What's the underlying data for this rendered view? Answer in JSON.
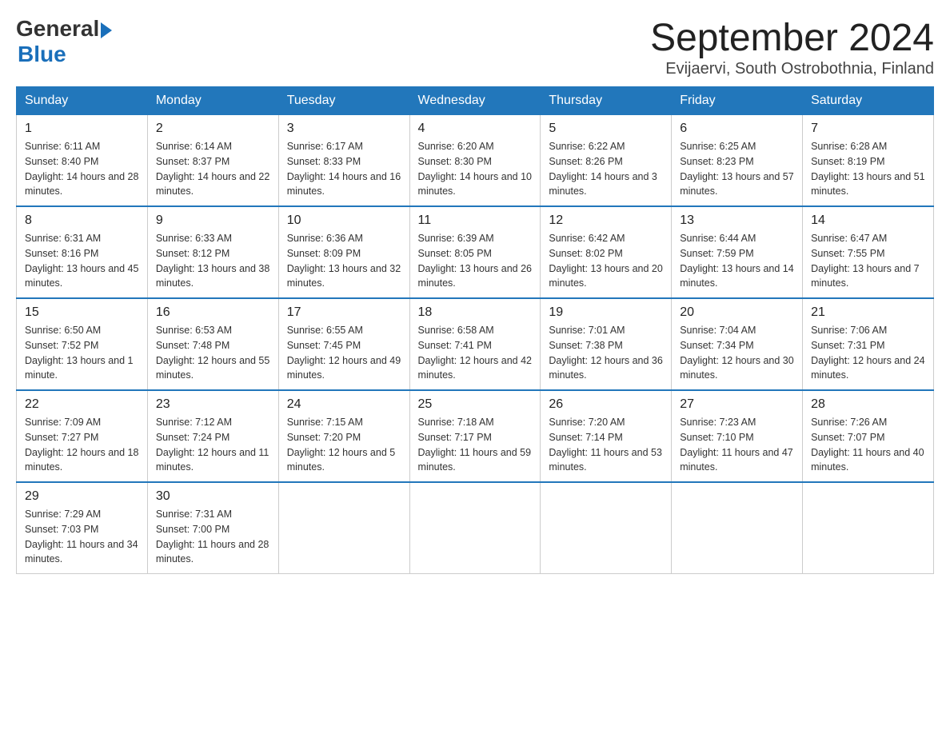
{
  "header": {
    "logo": {
      "general": "General",
      "blue": "Blue"
    },
    "month_title": "September 2024",
    "location": "Evijaervi, South Ostrobothnia, Finland"
  },
  "weekdays": [
    "Sunday",
    "Monday",
    "Tuesday",
    "Wednesday",
    "Thursday",
    "Friday",
    "Saturday"
  ],
  "weeks": [
    [
      {
        "day": "1",
        "sunrise": "6:11 AM",
        "sunset": "8:40 PM",
        "daylight": "14 hours and 28 minutes."
      },
      {
        "day": "2",
        "sunrise": "6:14 AM",
        "sunset": "8:37 PM",
        "daylight": "14 hours and 22 minutes."
      },
      {
        "day": "3",
        "sunrise": "6:17 AM",
        "sunset": "8:33 PM",
        "daylight": "14 hours and 16 minutes."
      },
      {
        "day": "4",
        "sunrise": "6:20 AM",
        "sunset": "8:30 PM",
        "daylight": "14 hours and 10 minutes."
      },
      {
        "day": "5",
        "sunrise": "6:22 AM",
        "sunset": "8:26 PM",
        "daylight": "14 hours and 3 minutes."
      },
      {
        "day": "6",
        "sunrise": "6:25 AM",
        "sunset": "8:23 PM",
        "daylight": "13 hours and 57 minutes."
      },
      {
        "day": "7",
        "sunrise": "6:28 AM",
        "sunset": "8:19 PM",
        "daylight": "13 hours and 51 minutes."
      }
    ],
    [
      {
        "day": "8",
        "sunrise": "6:31 AM",
        "sunset": "8:16 PM",
        "daylight": "13 hours and 45 minutes."
      },
      {
        "day": "9",
        "sunrise": "6:33 AM",
        "sunset": "8:12 PM",
        "daylight": "13 hours and 38 minutes."
      },
      {
        "day": "10",
        "sunrise": "6:36 AM",
        "sunset": "8:09 PM",
        "daylight": "13 hours and 32 minutes."
      },
      {
        "day": "11",
        "sunrise": "6:39 AM",
        "sunset": "8:05 PM",
        "daylight": "13 hours and 26 minutes."
      },
      {
        "day": "12",
        "sunrise": "6:42 AM",
        "sunset": "8:02 PM",
        "daylight": "13 hours and 20 minutes."
      },
      {
        "day": "13",
        "sunrise": "6:44 AM",
        "sunset": "7:59 PM",
        "daylight": "13 hours and 14 minutes."
      },
      {
        "day": "14",
        "sunrise": "6:47 AM",
        "sunset": "7:55 PM",
        "daylight": "13 hours and 7 minutes."
      }
    ],
    [
      {
        "day": "15",
        "sunrise": "6:50 AM",
        "sunset": "7:52 PM",
        "daylight": "13 hours and 1 minute."
      },
      {
        "day": "16",
        "sunrise": "6:53 AM",
        "sunset": "7:48 PM",
        "daylight": "12 hours and 55 minutes."
      },
      {
        "day": "17",
        "sunrise": "6:55 AM",
        "sunset": "7:45 PM",
        "daylight": "12 hours and 49 minutes."
      },
      {
        "day": "18",
        "sunrise": "6:58 AM",
        "sunset": "7:41 PM",
        "daylight": "12 hours and 42 minutes."
      },
      {
        "day": "19",
        "sunrise": "7:01 AM",
        "sunset": "7:38 PM",
        "daylight": "12 hours and 36 minutes."
      },
      {
        "day": "20",
        "sunrise": "7:04 AM",
        "sunset": "7:34 PM",
        "daylight": "12 hours and 30 minutes."
      },
      {
        "day": "21",
        "sunrise": "7:06 AM",
        "sunset": "7:31 PM",
        "daylight": "12 hours and 24 minutes."
      }
    ],
    [
      {
        "day": "22",
        "sunrise": "7:09 AM",
        "sunset": "7:27 PM",
        "daylight": "12 hours and 18 minutes."
      },
      {
        "day": "23",
        "sunrise": "7:12 AM",
        "sunset": "7:24 PM",
        "daylight": "12 hours and 11 minutes."
      },
      {
        "day": "24",
        "sunrise": "7:15 AM",
        "sunset": "7:20 PM",
        "daylight": "12 hours and 5 minutes."
      },
      {
        "day": "25",
        "sunrise": "7:18 AM",
        "sunset": "7:17 PM",
        "daylight": "11 hours and 59 minutes."
      },
      {
        "day": "26",
        "sunrise": "7:20 AM",
        "sunset": "7:14 PM",
        "daylight": "11 hours and 53 minutes."
      },
      {
        "day": "27",
        "sunrise": "7:23 AM",
        "sunset": "7:10 PM",
        "daylight": "11 hours and 47 minutes."
      },
      {
        "day": "28",
        "sunrise": "7:26 AM",
        "sunset": "7:07 PM",
        "daylight": "11 hours and 40 minutes."
      }
    ],
    [
      {
        "day": "29",
        "sunrise": "7:29 AM",
        "sunset": "7:03 PM",
        "daylight": "11 hours and 34 minutes."
      },
      {
        "day": "30",
        "sunrise": "7:31 AM",
        "sunset": "7:00 PM",
        "daylight": "11 hours and 28 minutes."
      },
      null,
      null,
      null,
      null,
      null
    ]
  ],
  "labels": {
    "sunrise": "Sunrise:",
    "sunset": "Sunset:",
    "daylight": "Daylight:"
  }
}
